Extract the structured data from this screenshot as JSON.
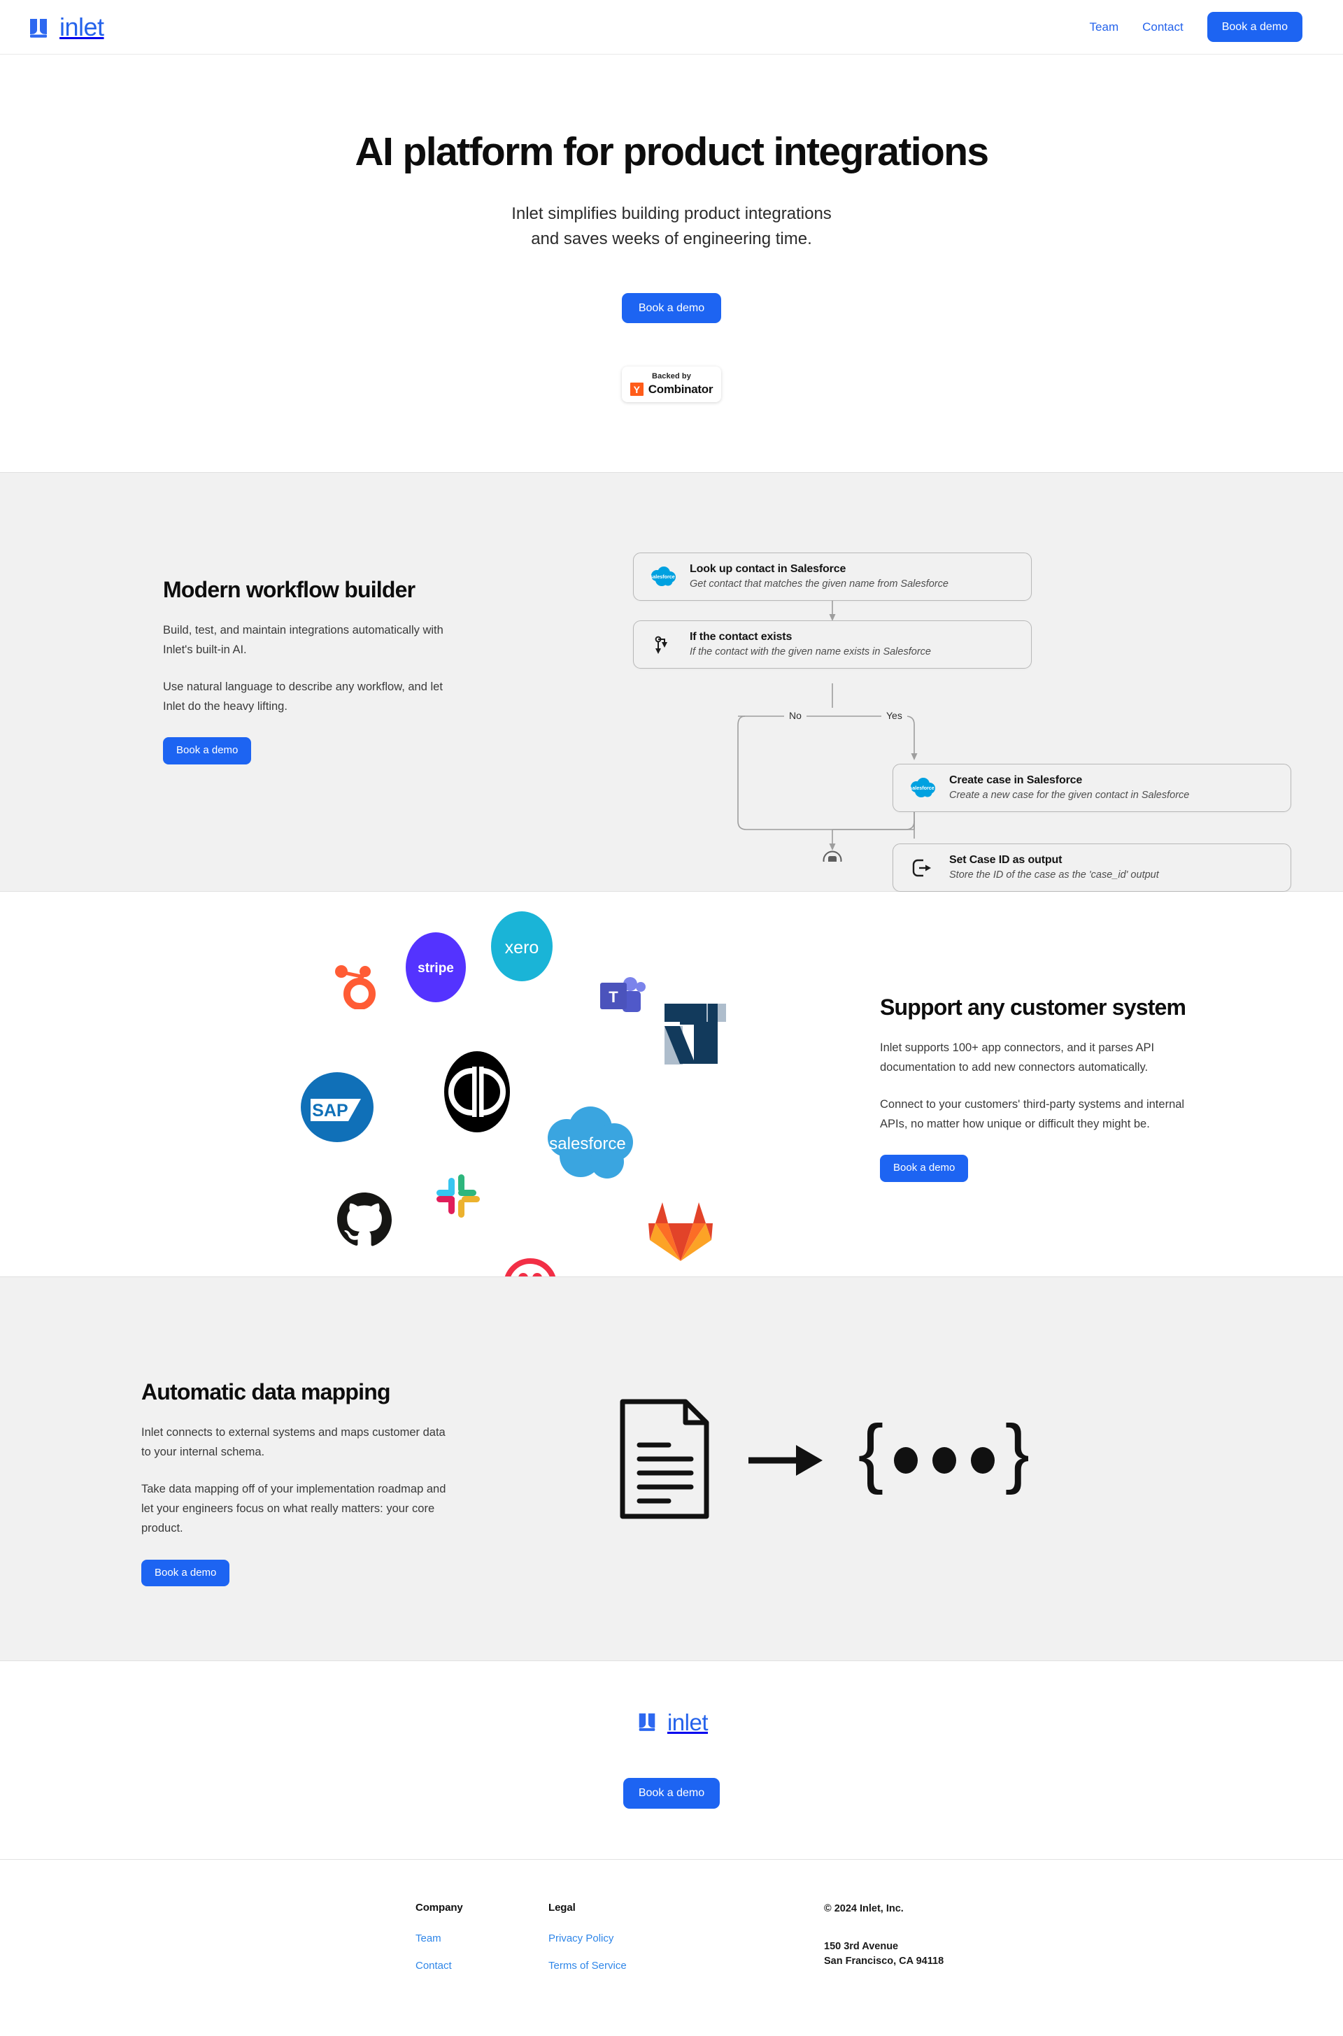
{
  "brand": {
    "name": "inlet",
    "logo_icon": "inlet-logo-icon",
    "color": "#2563eb"
  },
  "nav": {
    "links": [
      {
        "label": "Team"
      },
      {
        "label": "Contact"
      }
    ],
    "cta": "Book a demo"
  },
  "hero": {
    "title": "AI platform for product integrations",
    "subtitle_line1": "Inlet simplifies building product integrations",
    "subtitle_line2": "and saves weeks of engineering time.",
    "cta": "Book a demo",
    "badge": {
      "top": "Backed by",
      "mark": "Y",
      "name": "Combinator",
      "mark_color": "#ff5c1a"
    }
  },
  "workflow_section": {
    "title": "Modern workflow builder",
    "paragraph1": "Build, test, and maintain integrations automatically with Inlet's built-in AI.",
    "paragraph2": "Use natural language to describe any workflow, and let Inlet do the heavy lifting.",
    "cta": "Book a demo",
    "nodes": [
      {
        "id": "lookup-contact",
        "icon": "salesforce-icon",
        "title": "Look up contact in Salesforce",
        "desc": "Get contact that matches the given name from Salesforce"
      },
      {
        "id": "if-contact-exists",
        "icon": "branch-icon",
        "title": "If the contact exists",
        "desc": "If the contact with the given name exists in Salesforce"
      },
      {
        "id": "create-case",
        "icon": "salesforce-icon",
        "title": "Create case in Salesforce",
        "desc": "Create a new case for the given contact in Salesforce"
      },
      {
        "id": "set-case-id-output",
        "icon": "output-icon",
        "title": "Set Case ID as output",
        "desc": "Store the ID of the case as the 'case_id' output"
      }
    ],
    "branch_labels": {
      "no": "No",
      "yes": "Yes"
    }
  },
  "connectors_section": {
    "title": "Support any customer system",
    "paragraph1": "Inlet supports 100+ app connectors, and it parses API documentation to add new connectors automatically.",
    "paragraph2": "Connect to your customers' third-party systems and internal APIs, no matter how unique or difficult they might be.",
    "cta": "Book a demo",
    "logos": [
      {
        "name": "hubspot-logo"
      },
      {
        "name": "stripe-logo",
        "label": "stripe"
      },
      {
        "name": "xero-logo",
        "label": "xero"
      },
      {
        "name": "microsoft-teams-logo",
        "label": "T"
      },
      {
        "name": "netsuite-logo",
        "label": "N"
      },
      {
        "name": "sap-logo",
        "label": "SAP"
      },
      {
        "name": "quickbooks-logo",
        "label": "qb"
      },
      {
        "name": "salesforce-logo",
        "label": "salesforce"
      },
      {
        "name": "github-logo"
      },
      {
        "name": "slack-logo"
      },
      {
        "name": "twilio-logo"
      },
      {
        "name": "gitlab-logo"
      }
    ]
  },
  "mapping_section": {
    "title": "Automatic data mapping",
    "paragraph1": "Inlet connects to external systems and maps customer data to your internal schema.",
    "paragraph2": "Take data mapping off of your implementation roadmap and let your engineers focus on what really matters: your core product.",
    "cta": "Book a demo",
    "art": {
      "source_icon": "document-icon",
      "arrow_icon": "arrow-right-icon",
      "target_icon": "json-braces-icon"
    }
  },
  "footer": {
    "cta": "Book a demo",
    "company": {
      "heading": "Company",
      "links": [
        {
          "label": "Team"
        },
        {
          "label": "Contact"
        }
      ]
    },
    "legal": {
      "heading": "Legal",
      "links": [
        {
          "label": "Privacy Policy"
        },
        {
          "label": "Terms of Service"
        }
      ]
    },
    "meta": {
      "copyright": "© 2024 Inlet, Inc.",
      "address_line1": "150 3rd Avenue",
      "address_line2": "San Francisco, CA 94118"
    }
  }
}
